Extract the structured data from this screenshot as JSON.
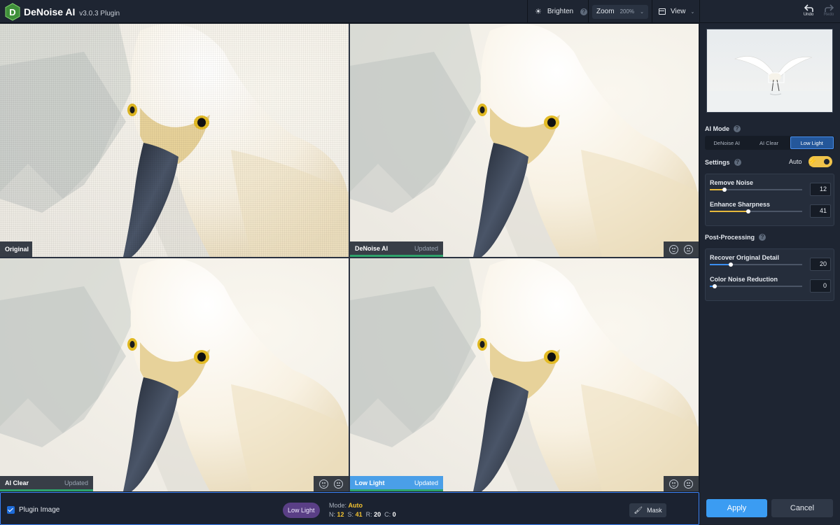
{
  "app": {
    "name": "DeNoise AI",
    "version": "v3.0.3 Plugin"
  },
  "toolbar": {
    "brighten_label": "Brighten",
    "zoom_label": "Zoom",
    "zoom_value": "200%",
    "view_label": "View",
    "undo_label": "Undo",
    "redo_label": "Redo"
  },
  "panels": [
    {
      "label": "Original",
      "status": ""
    },
    {
      "label": "DeNoise AI",
      "status": "Updated"
    },
    {
      "label": "AI Clear",
      "status": "Updated"
    },
    {
      "label": "Low Light",
      "status": "Updated"
    }
  ],
  "bottom": {
    "plugin_label": "Plugin Image",
    "mode_pill": "Low Light",
    "mode_prefix": "Mode:",
    "mode_value": "Auto",
    "n_label": "N:",
    "n_value": "12",
    "s_label": "S:",
    "s_value": "41",
    "r_label": "R:",
    "r_value": "20",
    "c_label": "C:",
    "c_value": "0",
    "mask_label": "Mask"
  },
  "sidebar": {
    "ai_mode_title": "AI Mode",
    "modes": [
      "DeNoise AI",
      "AI Clear",
      "Low Light"
    ],
    "active_mode": "Low Light",
    "settings_title": "Settings",
    "auto_label": "Auto",
    "auto_enabled": true,
    "settings": [
      {
        "label": "Remove Noise",
        "value": "12",
        "fraction": 0.16
      },
      {
        "label": "Enhance Sharpness",
        "value": "41",
        "fraction": 0.42
      }
    ],
    "post_title": "Post-Processing",
    "post": [
      {
        "label": "Recover Original Detail",
        "value": "20",
        "fraction": 0.23
      },
      {
        "label": "Color Noise Reduction",
        "value": "0",
        "fraction": 0.05
      }
    ],
    "apply_label": "Apply",
    "cancel_label": "Cancel"
  },
  "colors": {
    "accent_blue": "#3b9cf2",
    "active_green": "#2ea36b",
    "auto_yellow": "#f0c34b",
    "pill_purple": "#5a3f86"
  }
}
